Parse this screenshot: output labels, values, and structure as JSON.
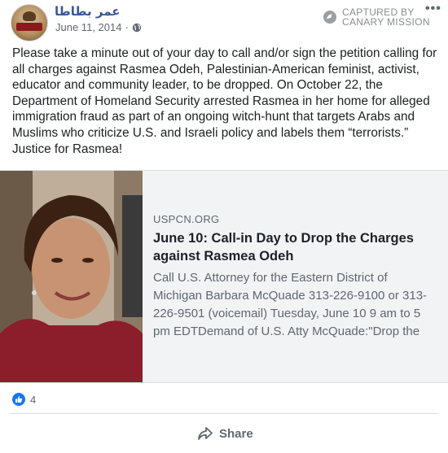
{
  "post": {
    "author": "عمر بطاطا",
    "date": "June 11, 2014",
    "privacy_icon": "globe-icon",
    "watermark": [
      "CAPTURED BY",
      "CANARY MISSION"
    ],
    "more_label": "•••",
    "text": "Please take a minute out of your day to call and/or sign the petition calling for all charges against Rasmea Odeh, Palestinian-American feminist, activist, educator and community leader, to be dropped. On October 22, the Department of Homeland Security arrested Rasmea in her home for alleged immigration fraud as part of an ongoing witch-hunt that targets Arabs and Muslims who criticize U.S. and Israeli policy and labels them “terrorists.” Justice for Rasmea!"
  },
  "link": {
    "domain": "USPCN.ORG",
    "title": "June 10: Call-in Day to Drop the Charges against Rasmea Odeh",
    "description": "Call U.S. Attorney for the Eastern District of Michigan Barbara McQuade 313-226-9100 or 313-226-9501 (voicemail) Tuesday, June 10 9 am to 5 pm EDTDemand of U.S. Atty McQuade:\"Drop the charges..."
  },
  "reactions": {
    "count": "4",
    "icon": "like-icon"
  },
  "actions": {
    "share_label": "Share",
    "share_icon": "share-arrow-icon"
  },
  "colors": {
    "accent": "#1877f2",
    "author": "#385898",
    "card_bg": "#f2f3f5"
  }
}
